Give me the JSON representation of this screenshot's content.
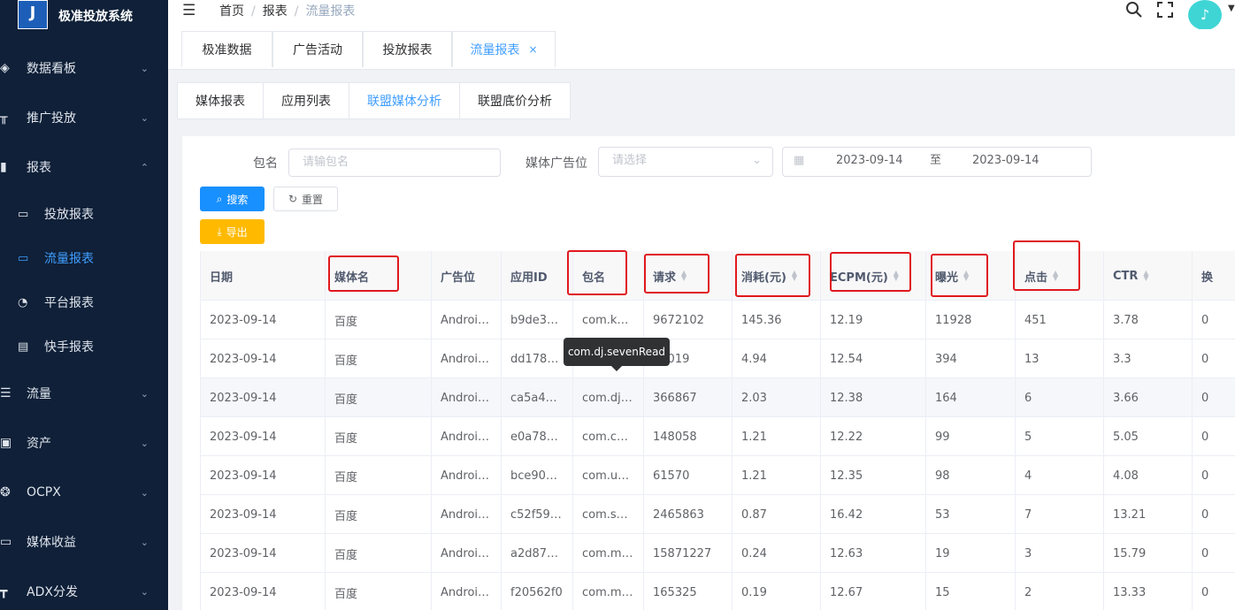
{
  "app": {
    "title": "极准投放系统",
    "logo_letter": "J"
  },
  "sidebar": {
    "items": [
      {
        "label": "数据看板",
        "icon": "dashboard-icon",
        "arrow": "⌄"
      },
      {
        "label": "推广投放",
        "icon": "promotion-icon",
        "arrow": "⌄"
      },
      {
        "label": "报表",
        "icon": "chart-bar-icon",
        "arrow": "⌃"
      },
      {
        "label": "流量",
        "icon": "database-icon",
        "arrow": "⌄"
      },
      {
        "label": "资产",
        "icon": "asset-icon",
        "arrow": "⌄"
      },
      {
        "label": "OCPX",
        "icon": "ocpx-icon",
        "arrow": "⌄"
      },
      {
        "label": "媒体收益",
        "icon": "revenue-icon",
        "arrow": "⌄"
      },
      {
        "label": "ADX分发",
        "icon": "network-icon",
        "arrow": "⌄"
      }
    ],
    "subitems": [
      {
        "label": "投放报表",
        "icon": "monitor-icon"
      },
      {
        "label": "流量报表",
        "icon": "traffic-icon",
        "active": true
      },
      {
        "label": "平台报表",
        "icon": "clock-icon"
      },
      {
        "label": "快手报表",
        "icon": "building-icon"
      }
    ]
  },
  "header": {
    "breadcrumb": [
      "首页",
      "报表",
      "流量报表"
    ]
  },
  "tags": [
    {
      "label": "极准数据"
    },
    {
      "label": "广告活动"
    },
    {
      "label": "投放报表"
    },
    {
      "label": "流量报表",
      "active": true,
      "close": "×"
    }
  ],
  "subtabs": [
    {
      "label": "媒体报表"
    },
    {
      "label": "应用列表"
    },
    {
      "label": "联盟媒体分析",
      "active": true
    },
    {
      "label": "联盟底价分析"
    }
  ],
  "filters": {
    "package_label": "包名",
    "package_placeholder": "请输包名",
    "slot_label": "媒体广告位",
    "slot_placeholder": "请选择",
    "date_start": "2023-09-14",
    "date_sep": "至",
    "date_end": "2023-09-14"
  },
  "buttons": {
    "search": "搜索",
    "reset": "重置",
    "export": "导出"
  },
  "table": {
    "headers": [
      "日期",
      "媒体名",
      "广告位",
      "应用ID",
      "包名",
      "请求",
      "消耗(元)",
      "ECPM(元)",
      "曝光",
      "点击",
      "CTR",
      "换"
    ],
    "rows": [
      [
        "2023-09-14",
        "百度",
        "Androi…",
        "b9de3…",
        "com.k…",
        "9672102",
        "145.36",
        "12.19",
        "11928",
        "451",
        "3.78",
        "0"
      ],
      [
        "2023-09-14",
        "百度",
        "Androi…",
        "dd178…",
        "",
        "37019",
        "4.94",
        "12.54",
        "394",
        "13",
        "3.3",
        "0"
      ],
      [
        "2023-09-14",
        "百度",
        "Androi…",
        "ca5a4…",
        "com.dj…",
        "366867",
        "2.03",
        "12.38",
        "164",
        "6",
        "3.66",
        "0"
      ],
      [
        "2023-09-14",
        "百度",
        "Androi…",
        "e0a78…",
        "com.c…",
        "148058",
        "1.21",
        "12.22",
        "99",
        "5",
        "5.05",
        "0"
      ],
      [
        "2023-09-14",
        "百度",
        "Androi…",
        "bce90…",
        "com.u…",
        "61570",
        "1.21",
        "12.35",
        "98",
        "4",
        "4.08",
        "0"
      ],
      [
        "2023-09-14",
        "百度",
        "Androi…",
        "c52f59…",
        "com.s…",
        "2465863",
        "0.87",
        "16.42",
        "53",
        "7",
        "13.21",
        "0"
      ],
      [
        "2023-09-14",
        "百度",
        "Androi…",
        "a2d87…",
        "com.m…",
        "15871227",
        "0.24",
        "12.63",
        "19",
        "3",
        "15.79",
        "0"
      ],
      [
        "2023-09-14",
        "百度",
        "Androi…",
        "f20562f0",
        "com.m…",
        "165325",
        "0.19",
        "12.67",
        "15",
        "2",
        "13.33",
        "0"
      ]
    ]
  },
  "tooltip": {
    "text": "com.dj.sevenRead"
  },
  "colors": {
    "sidebar_bg": "#0f2038",
    "primary": "#1890ff",
    "active": "#409eff",
    "warn": "#ffba00",
    "highlight_box": "#e0191e"
  }
}
